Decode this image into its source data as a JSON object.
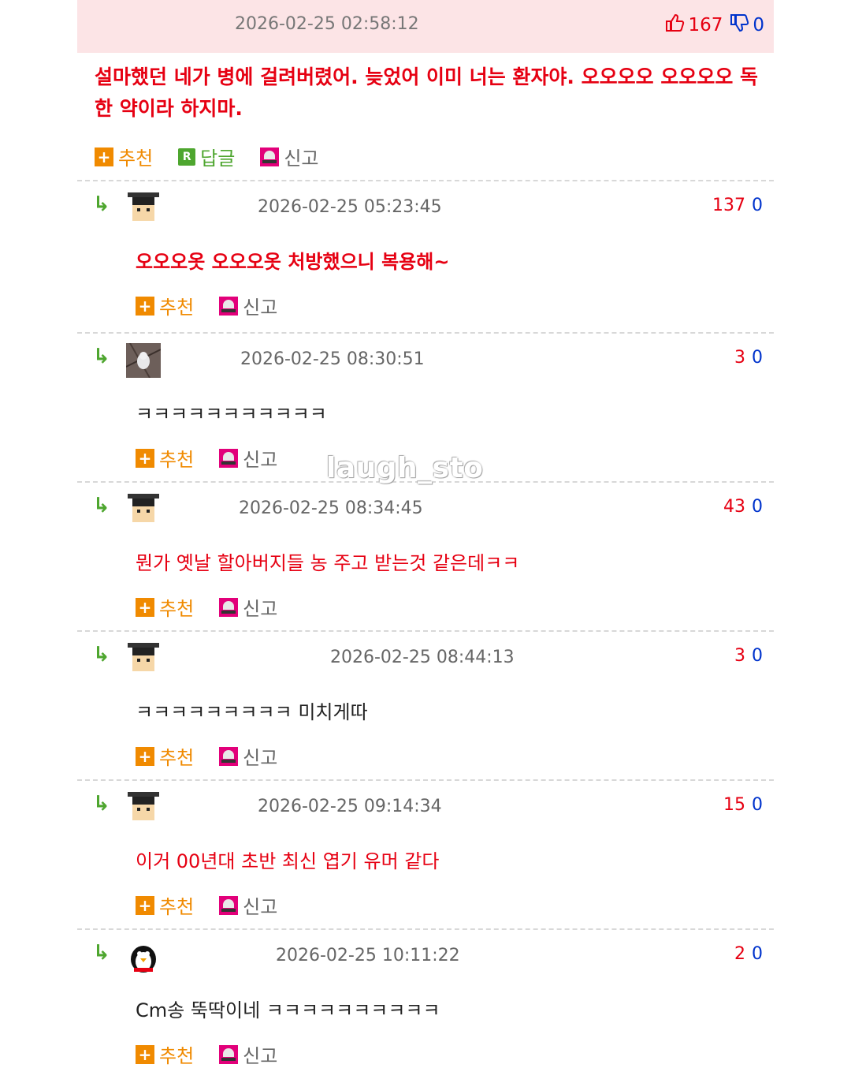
{
  "top_post": {
    "date": "2026-02-25 02:58:12",
    "up": "167",
    "down": "0",
    "body": "설마했던 네가 병에 걸려버렸어. 늦었어 이미 너는 환자야. 오오오오 오오오오 독한 약이라 하지마.",
    "actions": {
      "recommend": "추천",
      "reply": "답글",
      "report": "신고"
    }
  },
  "comments": [
    {
      "date": "2026-02-25 05:23:45",
      "up": "137",
      "down": "0",
      "text": "오오오옷 오오오옷 처방했으니 복용해~",
      "avatar": "graduate-cap",
      "style": "red bold"
    },
    {
      "date": "2026-02-25 08:30:51",
      "up": "3",
      "down": "0",
      "text": "ㅋㅋㅋㅋㅋㅋㅋㅋㅋㅋㅋ",
      "avatar": "photo",
      "style": "black"
    },
    {
      "date": "2026-02-25 08:34:45",
      "up": "43",
      "down": "0",
      "text": "뭔가 옛날 할아버지들 농 주고 받는것 같은데ㅋㅋ",
      "avatar": "graduate-cap",
      "style": "red"
    },
    {
      "date": "2026-02-25 08:44:13",
      "up": "3",
      "down": "0",
      "text": "ㅋㅋㅋㅋㅋㅋㅋㅋㅋ 미치게따",
      "avatar": "graduate-cap",
      "style": "black"
    },
    {
      "date": "2026-02-25 09:14:34",
      "up": "15",
      "down": "0",
      "text": "이거 00년대 초반 최신 엽기 유머 같다",
      "avatar": "graduate-cap",
      "style": "red"
    },
    {
      "date": "2026-02-25 10:11:22",
      "up": "2",
      "down": "0",
      "text": "Cm송 뚝딱이네 ㅋㅋㅋㅋㅋㅋㅋㅋㅋㅋ",
      "avatar": "penguin",
      "style": "black"
    }
  ],
  "comment_actions": {
    "recommend": "추천",
    "report": "신고"
  },
  "watermark": "laugh_sto",
  "colors": {
    "up": "#e60012",
    "down": "#0033cc",
    "recommend": "#f08a00",
    "reply_icon": "#4ea62f",
    "report_icon": "#e2007a",
    "top_bg": "#fce4e6"
  }
}
